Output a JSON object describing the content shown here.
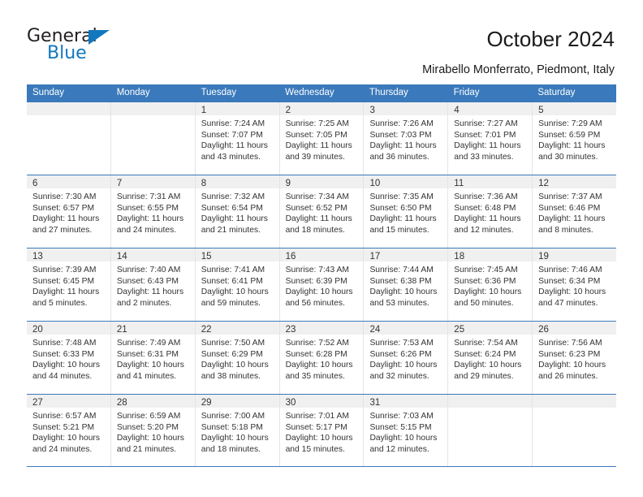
{
  "brand": {
    "name_part1": "General",
    "name_part2": "Blue",
    "accent_color": "#1278be",
    "header_color": "#3a79bb"
  },
  "header": {
    "title": "October 2024",
    "subtitle": "Mirabello Monferrato, Piedmont, Italy"
  },
  "calendar": {
    "weekday_headers": [
      "Sunday",
      "Monday",
      "Tuesday",
      "Wednesday",
      "Thursday",
      "Friday",
      "Saturday"
    ],
    "labels": {
      "sunrise_prefix": "Sunrise:",
      "sunset_prefix": "Sunset:",
      "daylight_prefix": "Daylight:"
    },
    "weeks": [
      [
        {
          "day": "",
          "empty": true
        },
        {
          "day": "",
          "empty": true
        },
        {
          "day": "1",
          "sunrise": "Sunrise: 7:24 AM",
          "sunset": "Sunset: 7:07 PM",
          "daylight_line1": "Daylight: 11 hours",
          "daylight_line2": "and 43 minutes."
        },
        {
          "day": "2",
          "sunrise": "Sunrise: 7:25 AM",
          "sunset": "Sunset: 7:05 PM",
          "daylight_line1": "Daylight: 11 hours",
          "daylight_line2": "and 39 minutes."
        },
        {
          "day": "3",
          "sunrise": "Sunrise: 7:26 AM",
          "sunset": "Sunset: 7:03 PM",
          "daylight_line1": "Daylight: 11 hours",
          "daylight_line2": "and 36 minutes."
        },
        {
          "day": "4",
          "sunrise": "Sunrise: 7:27 AM",
          "sunset": "Sunset: 7:01 PM",
          "daylight_line1": "Daylight: 11 hours",
          "daylight_line2": "and 33 minutes."
        },
        {
          "day": "5",
          "sunrise": "Sunrise: 7:29 AM",
          "sunset": "Sunset: 6:59 PM",
          "daylight_line1": "Daylight: 11 hours",
          "daylight_line2": "and 30 minutes."
        }
      ],
      [
        {
          "day": "6",
          "sunrise": "Sunrise: 7:30 AM",
          "sunset": "Sunset: 6:57 PM",
          "daylight_line1": "Daylight: 11 hours",
          "daylight_line2": "and 27 minutes."
        },
        {
          "day": "7",
          "sunrise": "Sunrise: 7:31 AM",
          "sunset": "Sunset: 6:55 PM",
          "daylight_line1": "Daylight: 11 hours",
          "daylight_line2": "and 24 minutes."
        },
        {
          "day": "8",
          "sunrise": "Sunrise: 7:32 AM",
          "sunset": "Sunset: 6:54 PM",
          "daylight_line1": "Daylight: 11 hours",
          "daylight_line2": "and 21 minutes."
        },
        {
          "day": "9",
          "sunrise": "Sunrise: 7:34 AM",
          "sunset": "Sunset: 6:52 PM",
          "daylight_line1": "Daylight: 11 hours",
          "daylight_line2": "and 18 minutes."
        },
        {
          "day": "10",
          "sunrise": "Sunrise: 7:35 AM",
          "sunset": "Sunset: 6:50 PM",
          "daylight_line1": "Daylight: 11 hours",
          "daylight_line2": "and 15 minutes."
        },
        {
          "day": "11",
          "sunrise": "Sunrise: 7:36 AM",
          "sunset": "Sunset: 6:48 PM",
          "daylight_line1": "Daylight: 11 hours",
          "daylight_line2": "and 12 minutes."
        },
        {
          "day": "12",
          "sunrise": "Sunrise: 7:37 AM",
          "sunset": "Sunset: 6:46 PM",
          "daylight_line1": "Daylight: 11 hours",
          "daylight_line2": "and 8 minutes."
        }
      ],
      [
        {
          "day": "13",
          "sunrise": "Sunrise: 7:39 AM",
          "sunset": "Sunset: 6:45 PM",
          "daylight_line1": "Daylight: 11 hours",
          "daylight_line2": "and 5 minutes."
        },
        {
          "day": "14",
          "sunrise": "Sunrise: 7:40 AM",
          "sunset": "Sunset: 6:43 PM",
          "daylight_line1": "Daylight: 11 hours",
          "daylight_line2": "and 2 minutes."
        },
        {
          "day": "15",
          "sunrise": "Sunrise: 7:41 AM",
          "sunset": "Sunset: 6:41 PM",
          "daylight_line1": "Daylight: 10 hours",
          "daylight_line2": "and 59 minutes."
        },
        {
          "day": "16",
          "sunrise": "Sunrise: 7:43 AM",
          "sunset": "Sunset: 6:39 PM",
          "daylight_line1": "Daylight: 10 hours",
          "daylight_line2": "and 56 minutes."
        },
        {
          "day": "17",
          "sunrise": "Sunrise: 7:44 AM",
          "sunset": "Sunset: 6:38 PM",
          "daylight_line1": "Daylight: 10 hours",
          "daylight_line2": "and 53 minutes."
        },
        {
          "day": "18",
          "sunrise": "Sunrise: 7:45 AM",
          "sunset": "Sunset: 6:36 PM",
          "daylight_line1": "Daylight: 10 hours",
          "daylight_line2": "and 50 minutes."
        },
        {
          "day": "19",
          "sunrise": "Sunrise: 7:46 AM",
          "sunset": "Sunset: 6:34 PM",
          "daylight_line1": "Daylight: 10 hours",
          "daylight_line2": "and 47 minutes."
        }
      ],
      [
        {
          "day": "20",
          "sunrise": "Sunrise: 7:48 AM",
          "sunset": "Sunset: 6:33 PM",
          "daylight_line1": "Daylight: 10 hours",
          "daylight_line2": "and 44 minutes."
        },
        {
          "day": "21",
          "sunrise": "Sunrise: 7:49 AM",
          "sunset": "Sunset: 6:31 PM",
          "daylight_line1": "Daylight: 10 hours",
          "daylight_line2": "and 41 minutes."
        },
        {
          "day": "22",
          "sunrise": "Sunrise: 7:50 AM",
          "sunset": "Sunset: 6:29 PM",
          "daylight_line1": "Daylight: 10 hours",
          "daylight_line2": "and 38 minutes."
        },
        {
          "day": "23",
          "sunrise": "Sunrise: 7:52 AM",
          "sunset": "Sunset: 6:28 PM",
          "daylight_line1": "Daylight: 10 hours",
          "daylight_line2": "and 35 minutes."
        },
        {
          "day": "24",
          "sunrise": "Sunrise: 7:53 AM",
          "sunset": "Sunset: 6:26 PM",
          "daylight_line1": "Daylight: 10 hours",
          "daylight_line2": "and 32 minutes."
        },
        {
          "day": "25",
          "sunrise": "Sunrise: 7:54 AM",
          "sunset": "Sunset: 6:24 PM",
          "daylight_line1": "Daylight: 10 hours",
          "daylight_line2": "and 29 minutes."
        },
        {
          "day": "26",
          "sunrise": "Sunrise: 7:56 AM",
          "sunset": "Sunset: 6:23 PM",
          "daylight_line1": "Daylight: 10 hours",
          "daylight_line2": "and 26 minutes."
        }
      ],
      [
        {
          "day": "27",
          "sunrise": "Sunrise: 6:57 AM",
          "sunset": "Sunset: 5:21 PM",
          "daylight_line1": "Daylight: 10 hours",
          "daylight_line2": "and 24 minutes."
        },
        {
          "day": "28",
          "sunrise": "Sunrise: 6:59 AM",
          "sunset": "Sunset: 5:20 PM",
          "daylight_line1": "Daylight: 10 hours",
          "daylight_line2": "and 21 minutes."
        },
        {
          "day": "29",
          "sunrise": "Sunrise: 7:00 AM",
          "sunset": "Sunset: 5:18 PM",
          "daylight_line1": "Daylight: 10 hours",
          "daylight_line2": "and 18 minutes."
        },
        {
          "day": "30",
          "sunrise": "Sunrise: 7:01 AM",
          "sunset": "Sunset: 5:17 PM",
          "daylight_line1": "Daylight: 10 hours",
          "daylight_line2": "and 15 minutes."
        },
        {
          "day": "31",
          "sunrise": "Sunrise: 7:03 AM",
          "sunset": "Sunset: 5:15 PM",
          "daylight_line1": "Daylight: 10 hours",
          "daylight_line2": "and 12 minutes."
        },
        {
          "day": "",
          "empty": true
        },
        {
          "day": "",
          "empty": true
        }
      ]
    ]
  }
}
